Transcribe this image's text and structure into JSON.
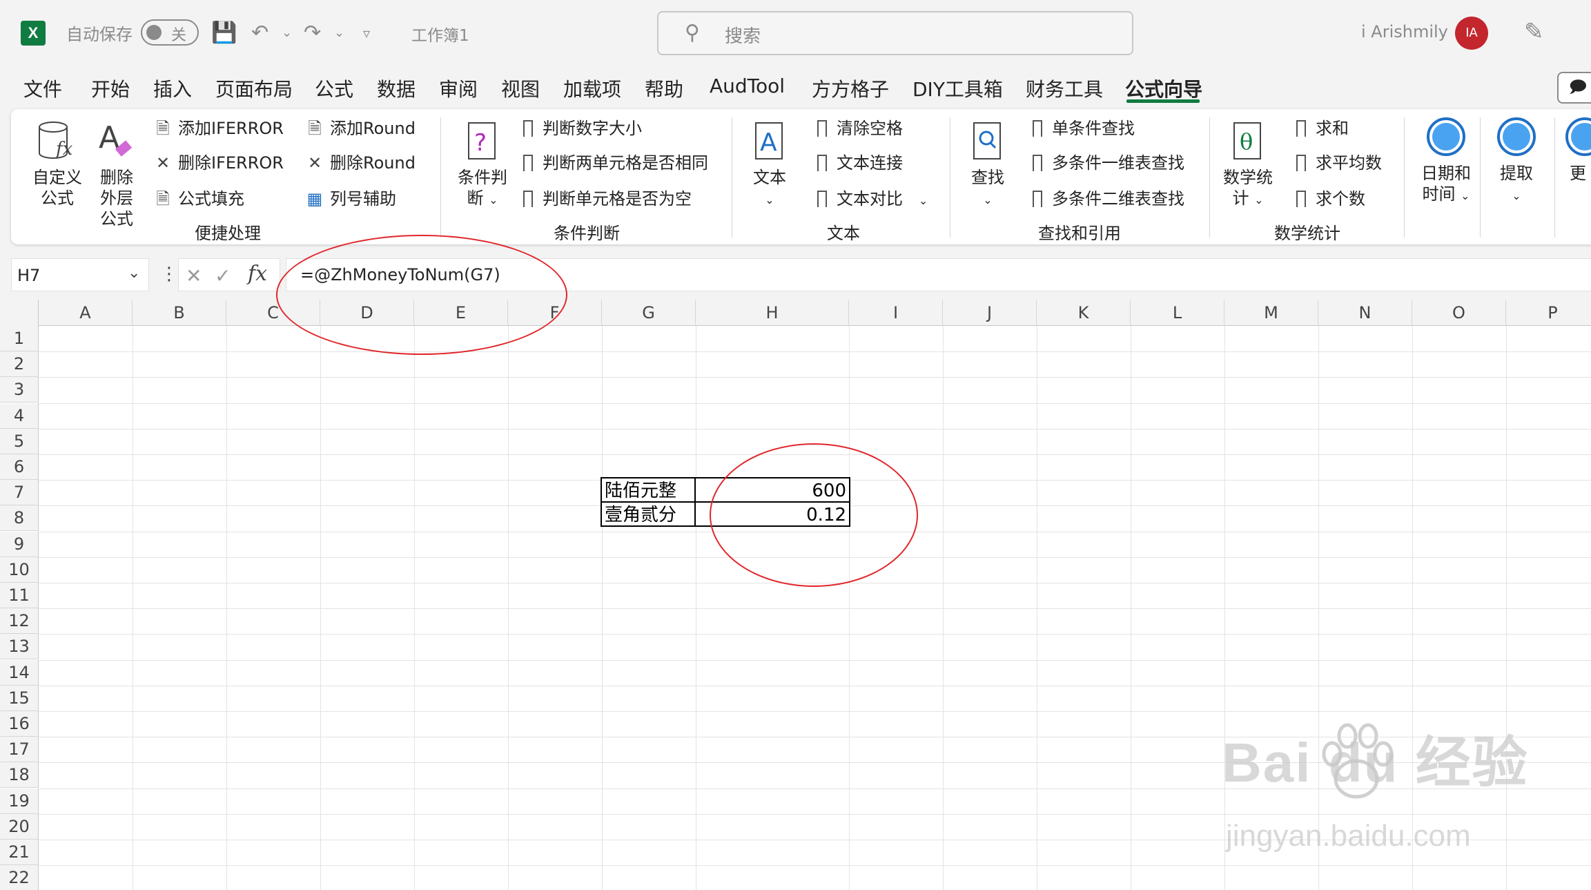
{
  "titlebar": {
    "autosave_label": "自动保存",
    "autosave_state": "关",
    "workbook_title": "工作簿1",
    "search_placeholder": "搜索",
    "user_name": "i Arishmily",
    "avatar_initials": "IA"
  },
  "menu": {
    "tabs": [
      "文件",
      "开始",
      "插入",
      "页面布局",
      "公式",
      "数据",
      "审阅",
      "视图",
      "加载项",
      "帮助",
      "AudTool",
      "方方格子",
      "DIY工具箱",
      "财务工具",
      "公式向导"
    ],
    "active_tab": "公式向导"
  },
  "ribbon": {
    "groups": {
      "convenience": {
        "label": "便捷处理",
        "custom_formula": "自定义公式",
        "remove_outer": "删除外层公式",
        "add_iferror": "添加IFERROR",
        "remove_iferror": "删除IFERROR",
        "formula_fill": "公式填充",
        "add_round": "添加Round",
        "remove_round": "删除Round",
        "column_helper": "列号辅助"
      },
      "condition": {
        "label": "条件判断",
        "big_button": "条件判断",
        "item1": "判断数字大小",
        "item2": "判断两单元格是否相同",
        "item3": "判断单元格是否为空"
      },
      "text": {
        "label": "文本",
        "big_button": "文本",
        "item1": "清除空格",
        "item2": "文本连接",
        "item3": "文本对比"
      },
      "lookup": {
        "label": "查找和引用",
        "big_button": "查找",
        "item1": "单条件查找",
        "item2": "多条件一维表查找",
        "item3": "多条件二维表查找"
      },
      "math": {
        "label": "数学统计",
        "big_button": "数学统计",
        "item1": "求和",
        "item2": "求平均数",
        "item3": "求个数"
      },
      "datetime": {
        "big_button": "日期和时间"
      },
      "extract": {
        "big_button": "提取"
      },
      "more": {
        "big_button": "更"
      }
    }
  },
  "formula_bar": {
    "name_box": "H7",
    "formula": "=@ZhMoneyToNum(G7)"
  },
  "sheet": {
    "columns": [
      "A",
      "B",
      "C",
      "D",
      "E",
      "F",
      "G",
      "H",
      "I",
      "J",
      "K",
      "L",
      "M",
      "N",
      "O",
      "P"
    ],
    "rows": [
      "1",
      "2",
      "3",
      "4",
      "5",
      "6",
      "7",
      "8",
      "9",
      "10",
      "11",
      "12",
      "13",
      "14",
      "15",
      "16",
      "17",
      "18",
      "19",
      "20",
      "21",
      "22"
    ],
    "cells": {
      "G7": "陆佰元整",
      "H7": "600",
      "G8": "壹角贰分",
      "H8": "0.12"
    }
  },
  "watermark": {
    "brand": "Bai du 经验",
    "url": "jingyan.baidu.com"
  },
  "colors": {
    "excel_green": "#107c41",
    "annotation_red": "#e0262a",
    "avatar_red": "#c4262e"
  }
}
